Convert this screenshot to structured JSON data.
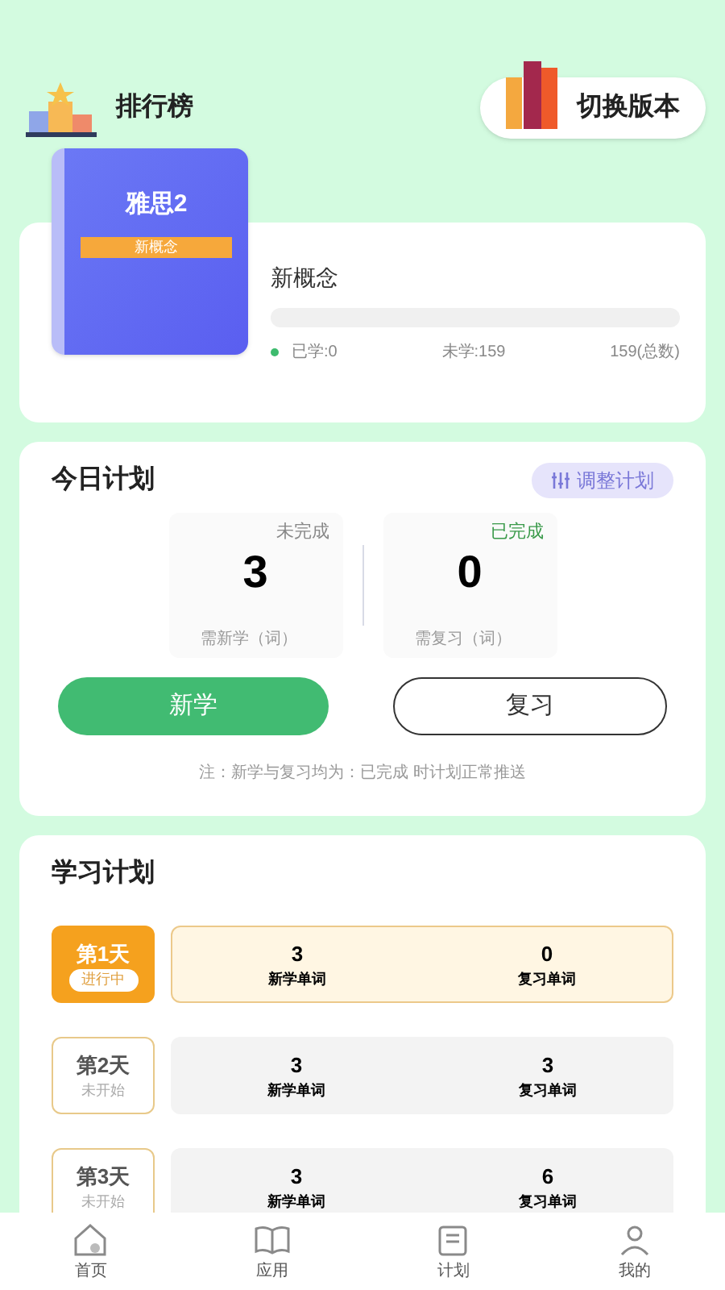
{
  "header": {
    "ranking": "排行榜",
    "switch_button": "切换版本"
  },
  "book": {
    "cover_title": "雅思2",
    "cover_tag": "新概念",
    "name": "新概念",
    "level": 0,
    "learned": "已学:0",
    "unlearned": "未学:159",
    "total": "159(总数)"
  },
  "today_plan": {
    "title": "今日计划",
    "adjust_button": "调整计划",
    "stats": [
      {
        "status": "未完成",
        "done": false,
        "value": "3",
        "caption": "需新学（词）"
      },
      {
        "status": "已完成",
        "done": true,
        "value": "0",
        "caption": "需复习（词）"
      }
    ],
    "learn_button": "新学",
    "review_button": "复习",
    "note": "注：新学与复习均为：已完成 时计划正常推送"
  },
  "study_plan": {
    "title": "学习计划",
    "days": [
      {
        "day": "第1天",
        "status": "进行中",
        "active": true,
        "new_count": "3",
        "new_label": "新学单词",
        "review_count": "0",
        "review_label": "复习单词"
      },
      {
        "day": "第2天",
        "status": "未开始",
        "active": false,
        "new_count": "3",
        "new_label": "新学单词",
        "review_count": "3",
        "review_label": "复习单词"
      },
      {
        "day": "第3天",
        "status": "未开始",
        "active": false,
        "new_count": "3",
        "new_label": "新学单词",
        "review_count": "6",
        "review_label": "复习单词"
      }
    ]
  },
  "tab_bar": [
    {
      "label": "首页",
      "kind": "home",
      "selected": false
    },
    {
      "label": "应用",
      "kind": "book",
      "selected": false
    },
    {
      "label": "计划",
      "kind": "plan",
      "selected": false
    },
    {
      "label": "我的",
      "kind": "user",
      "selected": false
    }
  ]
}
